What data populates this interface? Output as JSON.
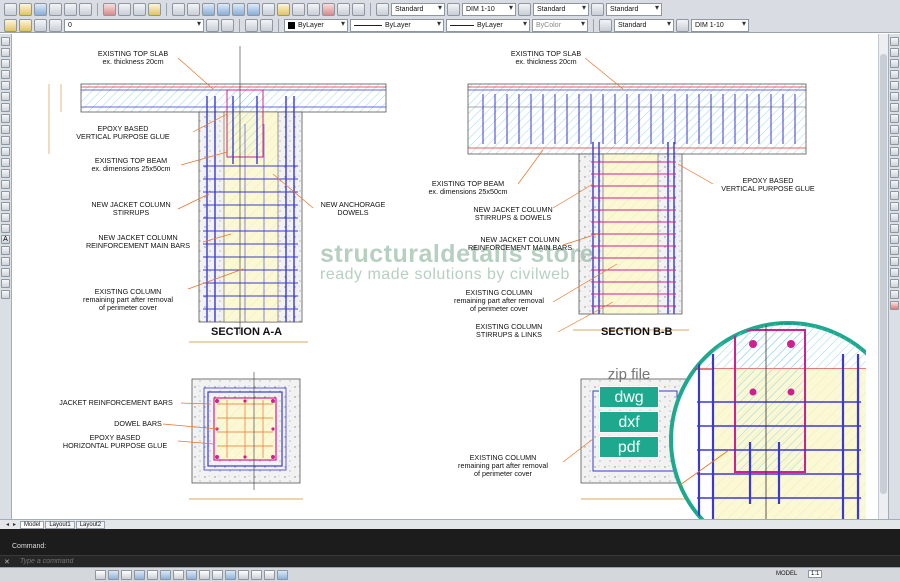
{
  "toolbar": {
    "layer_value": "0",
    "color_value": "ByLayer",
    "linetype_value": "ByLayer",
    "lineweight_value": "ByLayer",
    "plotstyle_value": "ByColor",
    "text_style": "Standard",
    "dim_style": "DIM 1-10",
    "table_style": "Standard",
    "multileader_style": "Standard",
    "text_style_2": "Standard",
    "dim_style_2": "DIM 1-10"
  },
  "left_toolbar": {
    "text_tool_glyph": "A"
  },
  "drawing": {
    "watermark": {
      "line1": "structuraldetails store",
      "line2": "ready made solutions by civilweb"
    },
    "section_aa": {
      "title": "SECTION A-A",
      "labels": {
        "existing_top_slab": "EXISTING TOP SLAB",
        "slab_thickness": "ex. thickness 20cm",
        "epoxy_vertical_1": "EPOXY BASED",
        "epoxy_vertical_2": "VERTICAL PURPOSE GLUE",
        "top_beam": "EXISTING TOP BEAM",
        "beam_dims": "ex. dimensions 25x50cm",
        "stirrups_1": "NEW JACKET COLUMN",
        "stirrups_2": "STIRRUPS",
        "main_bars_1": "NEW JACKET COLUMN",
        "main_bars_2": "REINFORCEMENT MAIN BARS",
        "existing_column": "EXISTING COLUMN",
        "remaining_1": "remaining part after removal",
        "remaining_2": "of perimeter cover",
        "anchorage_1": "NEW ANCHORAGE",
        "anchorage_2": "DOWELS"
      }
    },
    "plan_a": {
      "labels": {
        "jacket_bars": "JACKET REINFORCEMENT BARS",
        "dowel_bars": "DOWEL BARS",
        "epoxy_h1": "EPOXY BASED",
        "epoxy_h2": "HORIZONTAL PURPOSE GLUE"
      }
    },
    "section_bb": {
      "title": "SECTION B-B",
      "labels": {
        "existing_top_slab": "EXISTING TOP SLAB",
        "slab_thickness": "ex. thickness 20cm",
        "top_beam": "EXISTING TOP BEAM",
        "beam_dims": "ex. dimensions 25x50cm",
        "stirrups_dowels_1": "NEW JACKET COLUMN",
        "stirrups_dowels_2": "STIRRUPS & DOWELS",
        "main_bars_1": "NEW JACKET COLUMN",
        "main_bars_2": "REINFORCEMENT MAIN BARS",
        "existing_column": "EXISTING COLUMN",
        "remaining_1": "remaining part after removal",
        "remaining_2": "of perimeter cover",
        "col_stirrups_1": "EXISTING COLUMN",
        "col_stirrups_2": "STIRRUPS & LINKS",
        "epoxy_vertical_1": "EPOXY BASED",
        "epoxy_vertical_2": "VERTICAL PURPOSE GLUE"
      }
    },
    "plan_b": {
      "labels": {
        "existing_column": "EXISTING COLUMN",
        "remaining_1": "remaining part after removal",
        "remaining_2": "of perimeter cover"
      }
    },
    "zip_badge": {
      "title": "zip file",
      "formats": [
        "dwg",
        "dxf",
        "pdf"
      ]
    }
  },
  "tabs": {
    "items": [
      "Model",
      "Layout1",
      "Layout2"
    ]
  },
  "command_line": {
    "history": "Command:",
    "placeholder": "Type a command",
    "close_glyph": "✕"
  },
  "status_bar": {
    "model_label": "MODEL",
    "scale": "1:1"
  },
  "colors": {
    "rebar_blue": "#3a3ad0",
    "rebar_red": "#e02a2a",
    "glue_magenta": "#d0208f",
    "leader_orange": "#e8742a",
    "existing_column_fill": "#fbf8d6",
    "slab_hatch": "#7fcde6",
    "badge_green": "#1ea98e"
  }
}
